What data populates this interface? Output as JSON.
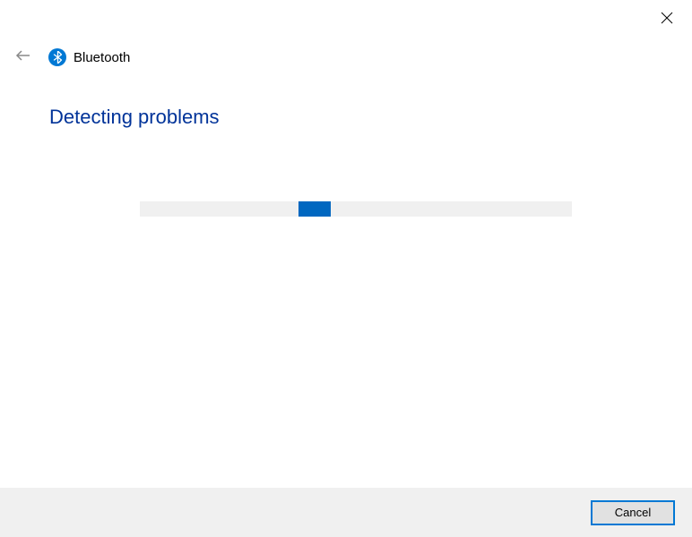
{
  "header": {
    "title": "Bluetooth"
  },
  "main": {
    "heading": "Detecting problems"
  },
  "footer": {
    "cancel_label": "Cancel"
  }
}
